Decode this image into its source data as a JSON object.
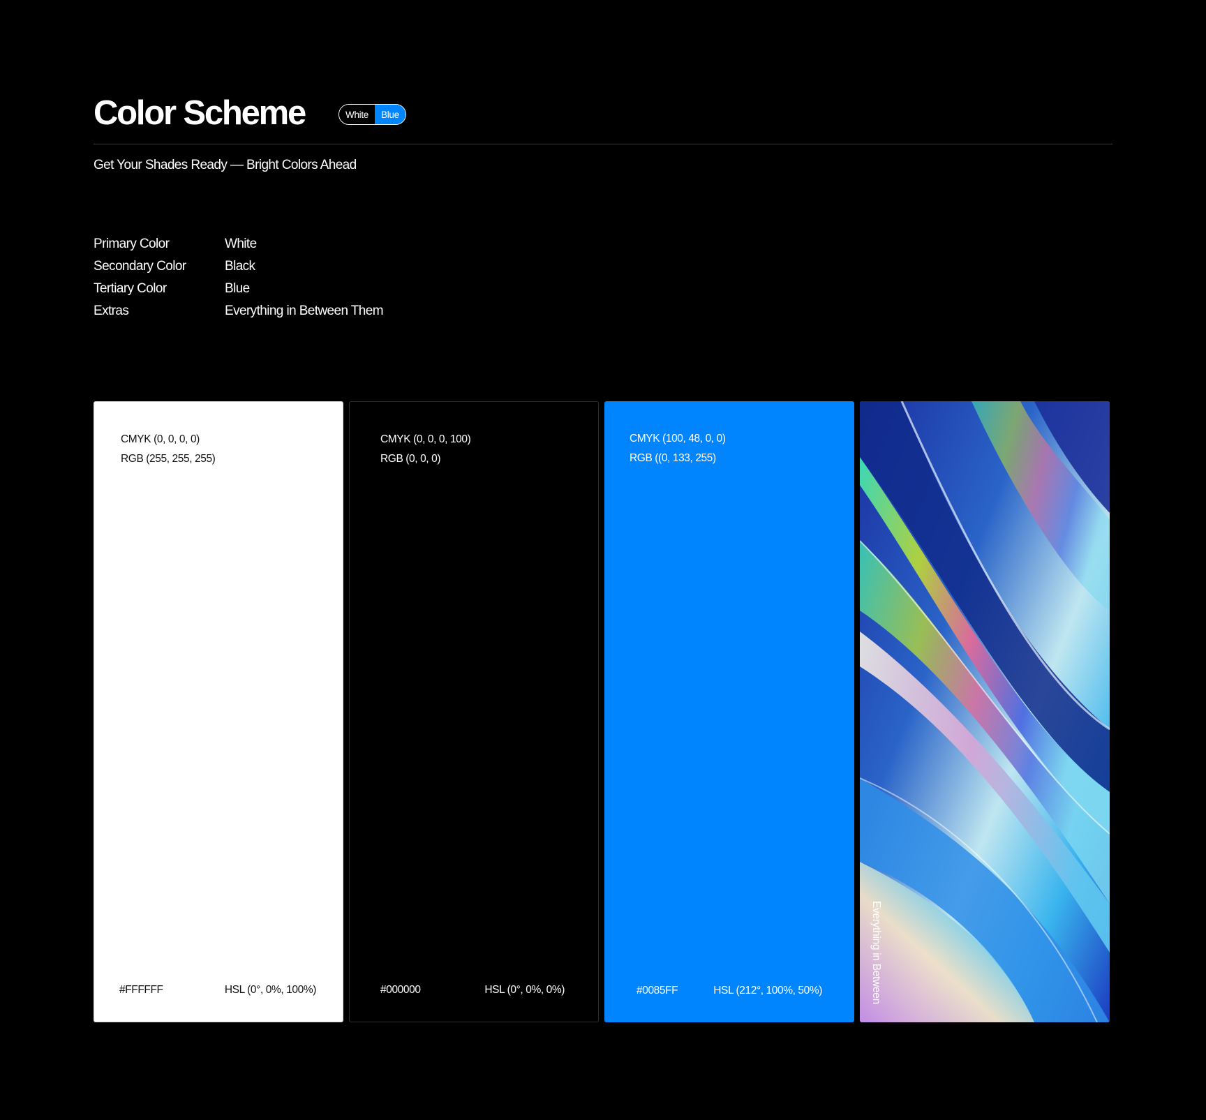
{
  "header": {
    "title": "Color Scheme",
    "toggle": {
      "options": [
        "White",
        "Blue"
      ],
      "selected": "Blue"
    },
    "subtitle": "Get Your Shades Ready — Bright Colors Ahead"
  },
  "specs": [
    {
      "label": "Primary Color",
      "value": "White"
    },
    {
      "label": "Secondary Color",
      "value": "Black"
    },
    {
      "label": "Tertiary Color",
      "value": "Blue"
    },
    {
      "label": "Extras",
      "value": "Everything in Between Them"
    }
  ],
  "swatches": [
    {
      "cmyk": "CMYK (0, 0, 0, 0)",
      "rgb": "RGB (255, 255, 255)",
      "hex": "#FFFFFF",
      "hsl": "HSL (0°, 0%, 100%)",
      "color": "#FFFFFF"
    },
    {
      "cmyk": "CMYK (0, 0, 0, 100)",
      "rgb": "RGB (0, 0, 0)",
      "hex": "#000000",
      "hsl": "HSL (0°, 0%, 0%)",
      "color": "#000000"
    },
    {
      "cmyk": "CMYK (100, 48, 0, 0)",
      "rgb": "RGB ((0, 133, 255)",
      "hex": "#0085FF",
      "hsl": "HSL (212°, 100%, 50%)",
      "color": "#0085FF"
    }
  ],
  "extras_card": {
    "label": "Everything in Between"
  }
}
